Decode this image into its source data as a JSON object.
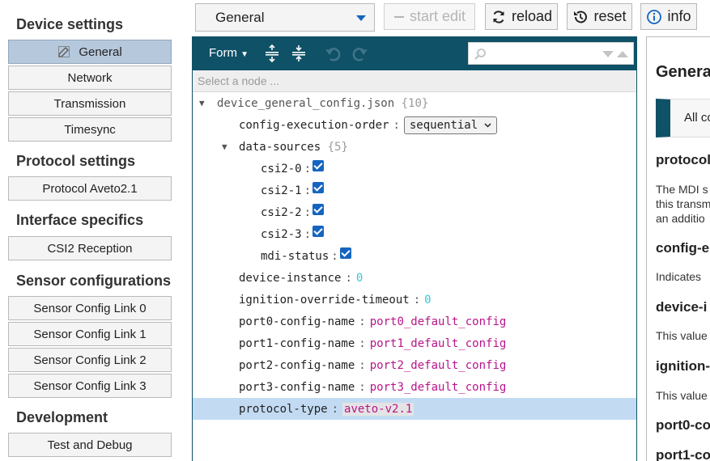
{
  "sidebar": {
    "sections": [
      {
        "title": "Device settings",
        "items": [
          "General",
          "Network",
          "Transmission",
          "Timesync"
        ]
      },
      {
        "title": "Protocol settings",
        "items": [
          "Protocol Aveto2.1"
        ]
      },
      {
        "title": "Interface specifics",
        "items": [
          "CSI2 Reception"
        ]
      },
      {
        "title": "Sensor configurations",
        "items": [
          "Sensor Config Link 0",
          "Sensor Config Link 1",
          "Sensor Config Link 2",
          "Sensor Config Link 3"
        ]
      },
      {
        "title": "Development",
        "items": [
          "Test and Debug"
        ]
      }
    ],
    "active_item": "General"
  },
  "toolbar": {
    "dropdown_value": "General",
    "start_edit": "start edit",
    "reload": "reload",
    "reset": "reset",
    "info": "info"
  },
  "editor": {
    "form_menu": "Form",
    "select_node_placeholder": "Select a node ...",
    "root_key": "device_general_config.json",
    "root_count": "{10}",
    "rows": {
      "exec_order_key": "config-execution-order",
      "exec_order_value": "sequential",
      "data_sources_key": "data-sources",
      "data_sources_count": "{5}",
      "csi0": "csi2-0",
      "csi1": "csi2-1",
      "csi2": "csi2-2",
      "csi3": "csi2-3",
      "mdi_status": "mdi-status",
      "device_instance_key": "device-instance",
      "device_instance_value": "0",
      "ignition_key": "ignition-override-timeout",
      "ignition_value": "0",
      "port0_key": "port0-config-name",
      "port0_value": "port0_default_config",
      "port1_key": "port1-config-name",
      "port1_value": "port1_default_config",
      "port2_key": "port2-config-name",
      "port2_value": "port2_default_config",
      "port3_key": "port3-config-name",
      "port3_value": "port3_default_config",
      "protocol_key": "protocol-type",
      "protocol_value": "aveto-v2.1"
    },
    "separator": ":"
  },
  "info_panel": {
    "title": "General",
    "tab": "All configurations",
    "headings": [
      "protocol",
      "config-e",
      "device-i",
      "ignition-",
      "port0-co",
      "port1-co"
    ],
    "texts": [
      "The MDI s",
      "this transm",
      "an additio",
      "Indicates",
      "This value",
      "This value"
    ]
  },
  "colors": {
    "header_bg": "#0f5167",
    "active_nav": "#b6c8dc",
    "selected_row": "#c2dbf3",
    "number": "#38c6d9",
    "string": "#b8148a",
    "checkbox": "#1565c0"
  }
}
